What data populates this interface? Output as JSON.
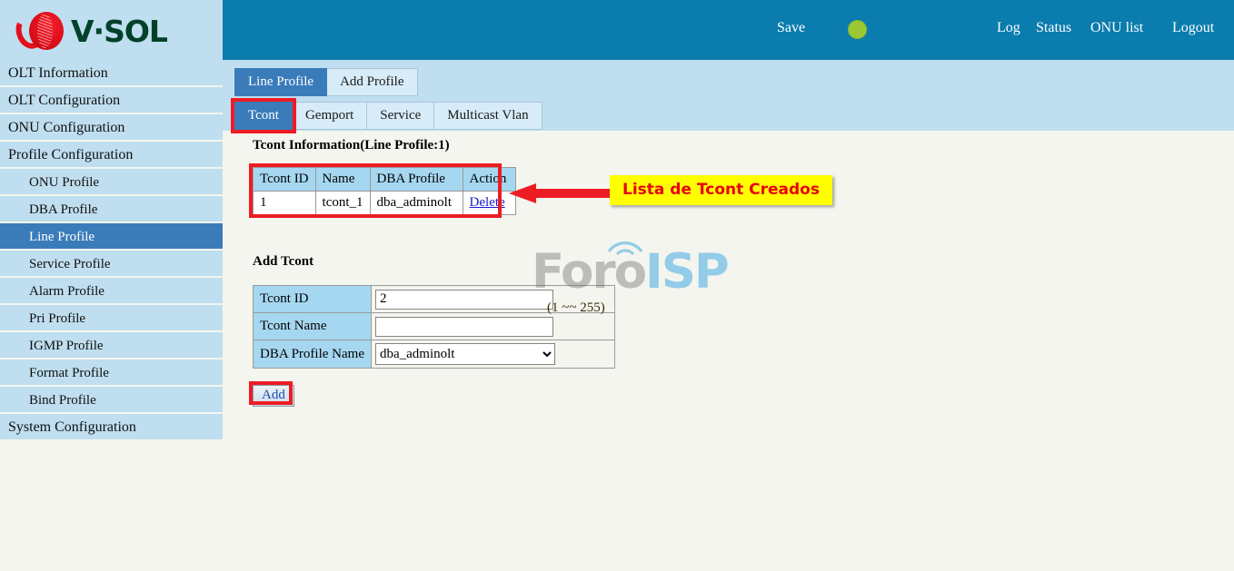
{
  "brand": {
    "name": "V·SOL",
    "logo_icon": "vsol-logo-icon"
  },
  "topbar": {
    "save": "Save",
    "status_dot": {
      "icon": "status-indicator-dot",
      "color": "#9ac832"
    },
    "log": "Log",
    "status": "Status",
    "onu_list": "ONU list",
    "logout": "Logout",
    "bg_color": "#0b7cae"
  },
  "tabs_primary": [
    {
      "label": "Line Profile",
      "active": true
    },
    {
      "label": "Add Profile",
      "active": false
    }
  ],
  "tabs_secondary": [
    {
      "label": "Tcont",
      "active": true,
      "highlighted": true
    },
    {
      "label": "Gemport",
      "active": false,
      "highlighted": false
    },
    {
      "label": "Service",
      "active": false,
      "highlighted": false
    },
    {
      "label": "Multicast Vlan",
      "active": false,
      "highlighted": false
    }
  ],
  "sidebar": {
    "items": [
      {
        "label": "OLT Information",
        "sub": false,
        "active": false
      },
      {
        "label": "OLT Configuration",
        "sub": false,
        "active": false
      },
      {
        "label": "ONU Configuration",
        "sub": false,
        "active": false
      },
      {
        "label": "Profile Configuration",
        "sub": false,
        "active": false
      },
      {
        "label": "ONU Profile",
        "sub": true,
        "active": false
      },
      {
        "label": "DBA Profile",
        "sub": true,
        "active": false
      },
      {
        "label": "Line Profile",
        "sub": true,
        "active": true
      },
      {
        "label": "Service Profile",
        "sub": true,
        "active": false
      },
      {
        "label": "Alarm Profile",
        "sub": true,
        "active": false
      },
      {
        "label": "Pri Profile",
        "sub": true,
        "active": false
      },
      {
        "label": "IGMP Profile",
        "sub": true,
        "active": false
      },
      {
        "label": "Format Profile",
        "sub": true,
        "active": false
      },
      {
        "label": "Bind Profile",
        "sub": true,
        "active": false
      },
      {
        "label": "System Configuration",
        "sub": false,
        "active": false
      }
    ]
  },
  "tcont_info": {
    "title": "Tcont Information(Line Profile:1)",
    "columns": [
      "Tcont ID",
      "Name",
      "DBA Profile",
      "Action"
    ],
    "rows": [
      {
        "id": "1",
        "name": "tcont_1",
        "dba_profile": "dba_adminolt",
        "action": "Delete"
      }
    ]
  },
  "annotation": {
    "text": "Lista de Tcont Creados",
    "arrow_icon": "left-arrow-annotation-icon",
    "box_color": "#ffff00",
    "text_color": "#e8000d"
  },
  "add_tcont": {
    "title": "Add Tcont",
    "fields": {
      "tcont_id_label": "Tcont ID",
      "tcont_id_value": "2",
      "tcont_id_hint": "(1 ~~ 255)",
      "tcont_name_label": "Tcont Name",
      "tcont_name_value": "",
      "tcont_name_placeholder": "",
      "dba_profile_label": "DBA Profile Name",
      "dba_profile_value": "dba_adminolt",
      "dba_profile_options": [
        "dba_adminolt"
      ]
    },
    "add_button": "Add"
  },
  "watermark": {
    "part1": "Foro",
    "part2": "ISP"
  }
}
